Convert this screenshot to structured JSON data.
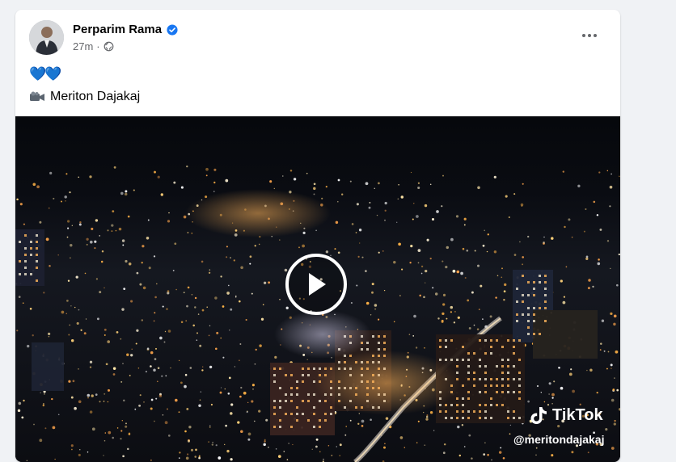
{
  "post": {
    "author": "Perparim Rama",
    "time": "27m",
    "separator": "·",
    "hearts": "💙💙",
    "caption_icon": "video-camera-icon",
    "caption": "Meriton Dajakaj"
  },
  "video": {
    "tiktok_brand": "TikTok",
    "tiktok_handle": "@meritondajakaj"
  },
  "colors": {
    "verified": "#1877f2",
    "meta_text": "#65676b"
  }
}
